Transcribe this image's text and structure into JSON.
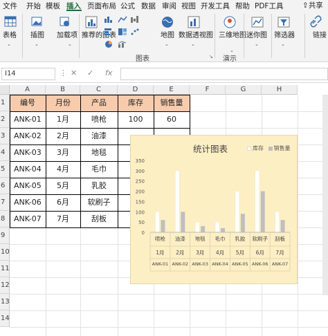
{
  "menu": {
    "items": [
      "文件",
      "开始",
      "模板",
      "插入",
      "页面布局",
      "公式",
      "数据",
      "审阅",
      "视图",
      "开发工具",
      "帮助",
      "PDF工具"
    ],
    "active": "插入",
    "share_label": "共享"
  },
  "ribbon": {
    "table_label": "表格",
    "illustration_label": "插图",
    "addin_label": "加载项",
    "recommended_chart_label": "推荐的图表",
    "maps_label": "地图",
    "pivot_chart_label": "数据透视图",
    "map3d_label": "三维地图",
    "sparkline_label": "迷你图",
    "filter_label": "筛选器",
    "link_label": "链接",
    "chart_group_label": "图表",
    "demo_group_label": "演示"
  },
  "formula_bar": {
    "name_box": "I14",
    "cancel_symbol": "✕",
    "enter_symbol": "✓",
    "fx_symbol": "fx",
    "value": ""
  },
  "sheet": {
    "columns": [
      "A",
      "B",
      "C",
      "D",
      "E",
      "F",
      "G",
      "H"
    ],
    "rows": [
      "1",
      "2",
      "3",
      "4",
      "5",
      "6",
      "7",
      "8",
      "9",
      "10",
      "11",
      "12",
      "13",
      "14"
    ],
    "table": {
      "headers": [
        "编号",
        "月份",
        "产品",
        "库存",
        "销售量"
      ],
      "rows": [
        [
          "ANK-01",
          "1月",
          "喷枪",
          "100",
          "60"
        ],
        [
          "ANK-02",
          "2月",
          "油漆",
          "",
          ""
        ],
        [
          "ANK-03",
          "3月",
          "地毯",
          "",
          ""
        ],
        [
          "ANK-04",
          "4月",
          "毛巾",
          "",
          ""
        ],
        [
          "ANK-05",
          "5月",
          "乳胶",
          "",
          ""
        ],
        [
          "ANK-06",
          "6月",
          "软刷子",
          "",
          ""
        ],
        [
          "ANK-07",
          "7月",
          "刮板",
          "",
          ""
        ]
      ]
    }
  },
  "chart_data": {
    "type": "bar",
    "title": "统计图表",
    "categories_level1": [
      "喷枪",
      "油漆",
      "地毯",
      "毛巾",
      "乳胶",
      "软刷子",
      "刮板"
    ],
    "categories_level2": [
      "1月",
      "2月",
      "3月",
      "4月",
      "5月",
      "6月",
      "7月"
    ],
    "categories_level3": [
      "ANK-01",
      "ANK-02",
      "ANK-03",
      "ANK-04",
      "ANK-05",
      "ANK-06",
      "ANK-07"
    ],
    "series": [
      {
        "name": "库存",
        "values": [
          100,
          300,
          50,
          50,
          200,
          300,
          100
        ],
        "color": "#ffffff"
      },
      {
        "name": "销售量",
        "values": [
          60,
          100,
          30,
          20,
          90,
          200,
          60
        ],
        "color": "#bfbfbf"
      }
    ],
    "yticks": [
      "0",
      "50",
      "100",
      "150",
      "200",
      "250",
      "300",
      "350"
    ],
    "ylim": [
      0,
      350
    ],
    "legend_position": "top-right",
    "background": "#fdefc4",
    "gridlines": false
  }
}
